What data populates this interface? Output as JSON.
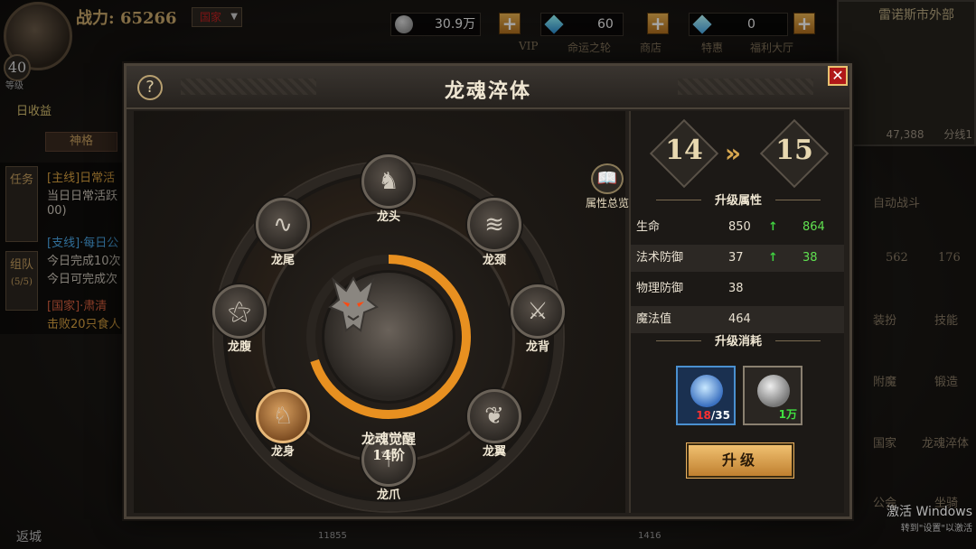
{
  "hud": {
    "power_label": "战力:",
    "power_value": "65266",
    "country": "国家",
    "level": "40",
    "level_sub": "等级",
    "daily_income": "日收益",
    "title_badge": "神格",
    "silver": "30.9万",
    "gems": "60",
    "vouchers": "0",
    "labels": {
      "vip": "VIP",
      "wheel": "命运之轮",
      "shop": "商店",
      "deals": "特惠",
      "welfare": "福利大厅"
    },
    "map_name": "雷诺斯市外部",
    "map_coord": "47,388",
    "map_line": "分线1",
    "side_buttons": [
      "自动战斗",
      "装扮",
      "技能",
      "附魔",
      "锻造",
      "国家",
      "龙魂淬体",
      "公会",
      "坐骑"
    ],
    "side_counts": [
      "562",
      "176"
    ],
    "left_tabs": {
      "task": "任务",
      "team": "组队",
      "team_count": "(5/5)"
    },
    "quests": [
      {
        "text": "[主线]日常活",
        "color": "#d8a040"
      },
      {
        "text": "当日日常活跃",
        "color": "#cfc8bc"
      },
      {
        "text": "00)",
        "color": "#cfc8bc"
      },
      {
        "text": "[支线]·每日公",
        "color": "#4aa8e8"
      },
      {
        "text": "今日完成10次",
        "color": "#cfc8bc"
      },
      {
        "text": "今日可完成次",
        "color": "#cfc8bc"
      },
      {
        "text": "[国家]·肃清",
        "color": "#d86040"
      },
      {
        "text": "击败20只食人",
        "color": "#d8a040"
      }
    ],
    "return_label": "返城",
    "bottom_left_num": "11855",
    "bottom_right_num": "1416",
    "win_activate": "激活 Windows",
    "win_activate_sub": "转到\"设置\"以激活"
  },
  "modal": {
    "title": "龙魂淬体",
    "codex_label": "属性总览",
    "parts": [
      {
        "name": "龙头",
        "icon": "dragon-head-icon",
        "glyph": "♞",
        "active": false
      },
      {
        "name": "龙颈",
        "icon": "dragon-neck-icon",
        "glyph": "≋",
        "active": false
      },
      {
        "name": "龙背",
        "icon": "dragon-back-icon",
        "glyph": "⚔",
        "active": false
      },
      {
        "name": "龙翼",
        "icon": "dragon-wing-icon",
        "glyph": "❦",
        "active": false
      },
      {
        "name": "龙爪",
        "icon": "dragon-claw-icon",
        "glyph": "⚚",
        "active": false
      },
      {
        "name": "龙身",
        "icon": "dragon-body-icon",
        "glyph": "♘",
        "active": true
      },
      {
        "name": "龙腹",
        "icon": "dragon-belly-icon",
        "glyph": "⚝",
        "active": false
      },
      {
        "name": "龙尾",
        "icon": "dragon-tail-icon",
        "glyph": "∿",
        "active": false
      }
    ],
    "core": {
      "name": "龙魂觉醒",
      "tier": "14阶",
      "progress": 0.7
    },
    "level_from": "14",
    "level_to": "15",
    "attr_title": "升级属性",
    "stats": [
      {
        "name": "生命",
        "value": "850",
        "up": "↑",
        "new": "864"
      },
      {
        "name": "法术防御",
        "value": "37",
        "up": "↑",
        "new": "38"
      },
      {
        "name": "物理防御",
        "value": "38",
        "up": "",
        "new": ""
      },
      {
        "name": "魔法值",
        "value": "464",
        "up": "",
        "new": ""
      }
    ],
    "cost_title": "升级消耗",
    "costs": [
      {
        "icon": "blue-flower-icon",
        "have": "18",
        "need": "/35",
        "have_color": "#ff3030",
        "need_color": "#ffffff"
      },
      {
        "icon": "silver-coin-icon",
        "have": "1万",
        "need": "",
        "have_color": "#40e040",
        "need_color": "#40e040"
      }
    ],
    "upgrade_label": "升级"
  },
  "colors": {
    "accent": "#e8a040",
    "progress_arc": "#e89020",
    "up_arrow": "#40d040"
  }
}
